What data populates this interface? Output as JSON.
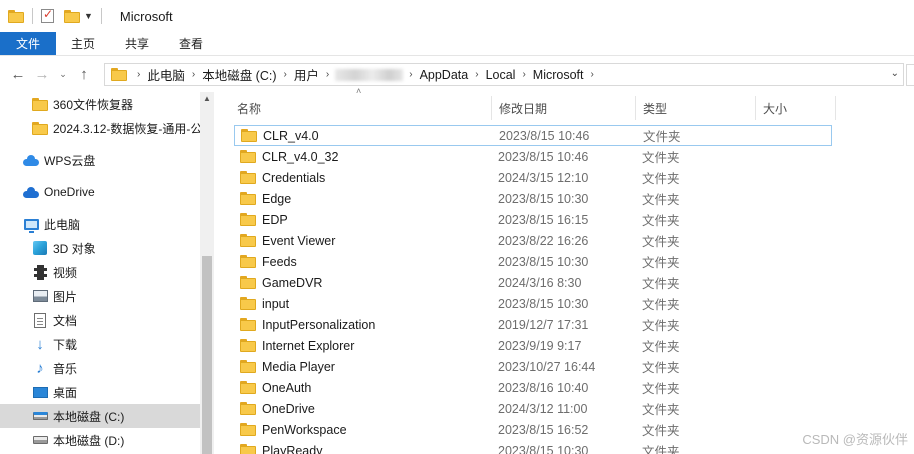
{
  "window": {
    "title": "Microsoft"
  },
  "ribbon": {
    "tabs": [
      "文件",
      "主页",
      "共享",
      "查看"
    ]
  },
  "nav": {
    "back": "←",
    "forward": "→",
    "recent": "⌄",
    "up": "↑",
    "dropdown": "⌄"
  },
  "address": {
    "crumbs": [
      "此电脑",
      "本地磁盘 (C:)",
      "用户",
      "AppData",
      "Local",
      "Microsoft"
    ],
    "separator": "›"
  },
  "sidebar": {
    "items": [
      {
        "label": "360文件恢复器",
        "icon": "folder-icon"
      },
      {
        "label": "2024.3.12-数据恢复-通用-公",
        "icon": "folder-icon"
      },
      {
        "label": "WPS云盘",
        "icon": "wps-cloud-icon"
      },
      {
        "label": "OneDrive",
        "icon": "onedrive-icon"
      },
      {
        "label": "此电脑",
        "icon": "this-pc-icon"
      },
      {
        "label": "3D 对象",
        "icon": "3d-objects-icon"
      },
      {
        "label": "视频",
        "icon": "video-icon"
      },
      {
        "label": "图片",
        "icon": "pictures-icon"
      },
      {
        "label": "文档",
        "icon": "documents-icon"
      },
      {
        "label": "下载",
        "icon": "download-icon"
      },
      {
        "label": "音乐",
        "icon": "music-icon"
      },
      {
        "label": "桌面",
        "icon": "desktop-icon"
      },
      {
        "label": "本地磁盘 (C:)",
        "icon": "drive-c-icon",
        "selected": true
      },
      {
        "label": "本地磁盘 (D:)",
        "icon": "drive-d-icon"
      }
    ]
  },
  "columns": [
    "名称",
    "修改日期",
    "类型",
    "大小"
  ],
  "files": [
    {
      "name": "CLR_v4.0",
      "date": "2023/8/15 10:46",
      "type": "文件夹"
    },
    {
      "name": "CLR_v4.0_32",
      "date": "2023/8/15 10:46",
      "type": "文件夹"
    },
    {
      "name": "Credentials",
      "date": "2024/3/15 12:10",
      "type": "文件夹"
    },
    {
      "name": "Edge",
      "date": "2023/8/15 10:30",
      "type": "文件夹"
    },
    {
      "name": "EDP",
      "date": "2023/8/15 16:15",
      "type": "文件夹"
    },
    {
      "name": "Event Viewer",
      "date": "2023/8/22 16:26",
      "type": "文件夹"
    },
    {
      "name": "Feeds",
      "date": "2023/8/15 10:30",
      "type": "文件夹"
    },
    {
      "name": "GameDVR",
      "date": "2024/3/16 8:30",
      "type": "文件夹"
    },
    {
      "name": "input",
      "date": "2023/8/15 10:30",
      "type": "文件夹"
    },
    {
      "name": "InputPersonalization",
      "date": "2019/12/7 17:31",
      "type": "文件夹"
    },
    {
      "name": "Internet Explorer",
      "date": "2023/9/19 9:17",
      "type": "文件夹"
    },
    {
      "name": "Media Player",
      "date": "2023/10/27 16:44",
      "type": "文件夹"
    },
    {
      "name": "OneAuth",
      "date": "2023/8/16 10:40",
      "type": "文件夹"
    },
    {
      "name": "OneDrive",
      "date": "2024/3/12 11:00",
      "type": "文件夹"
    },
    {
      "name": "PenWorkspace",
      "date": "2023/8/15 16:52",
      "type": "文件夹"
    },
    {
      "name": "PlayReady",
      "date": "2023/8/15 10:30",
      "type": "文件夹"
    }
  ],
  "watermark": "CSDN @资源伙伴",
  "colors": {
    "accent": "#1a6fc9",
    "folder": "#f8c94a",
    "selection": "#d9d9d9",
    "focus_border": "#99c9ef"
  }
}
